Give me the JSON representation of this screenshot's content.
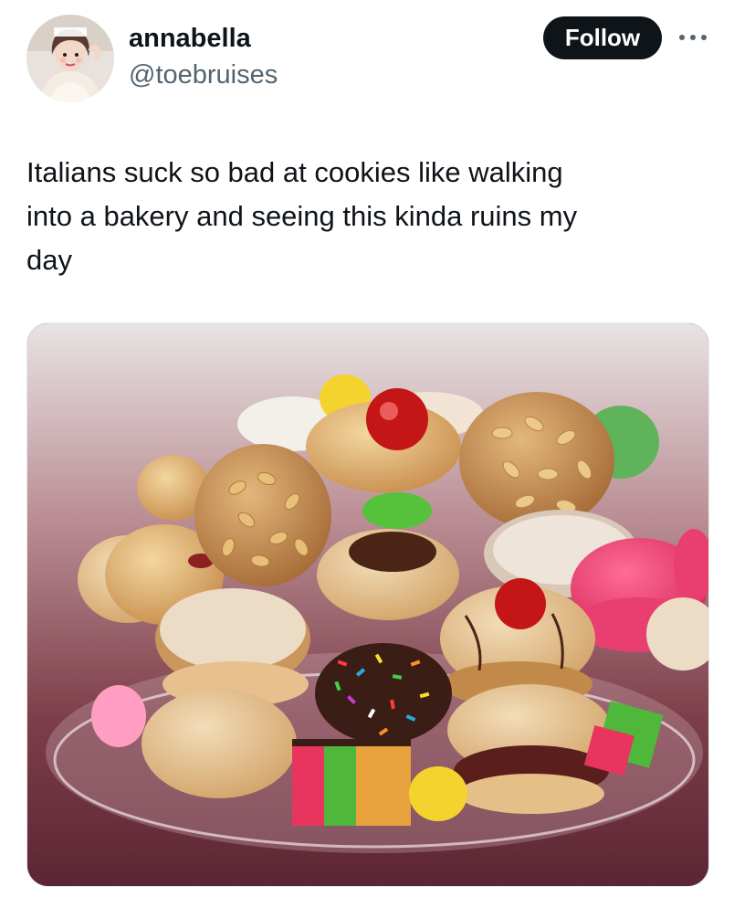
{
  "tweet": {
    "author": {
      "display_name": "annabella",
      "handle": "@toebruises"
    },
    "follow_label": "Follow",
    "more_icon": "more-horizontal-icon",
    "text": "Italians suck so bad at cookies like walking\ninto a bakery and seeing this kinda ruins my\nday",
    "media": {
      "kind": "photo",
      "subject": "Italian cookie assortment"
    }
  },
  "colors": {
    "follow_bg": "#0f1419",
    "handle": "#536471",
    "text": "#0f1419"
  }
}
